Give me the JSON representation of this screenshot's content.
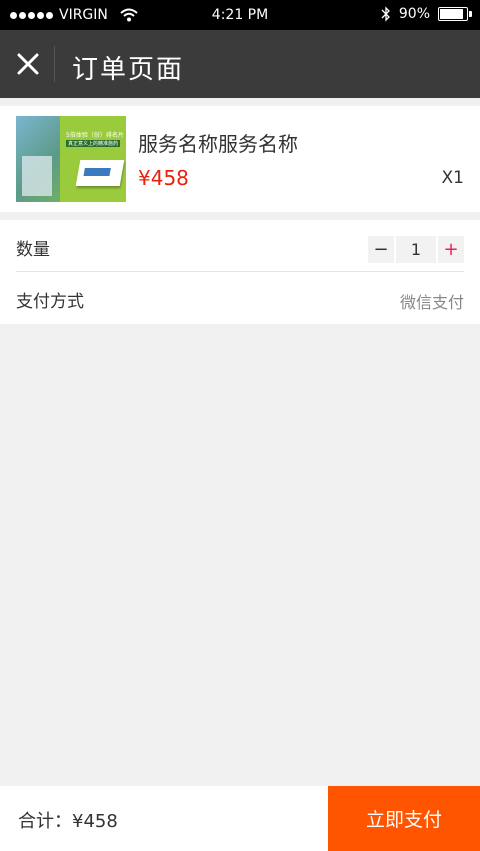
{
  "status_bar": {
    "carrier": "VIRGIN",
    "time": "4:21 PM",
    "battery": "90%",
    "battery_level": 0.9
  },
  "nav": {
    "title": "订单页面"
  },
  "product": {
    "image_text_line1": "5倍体验（份）排名片",
    "image_text_line2": "真正意义上的精准施药",
    "name": "服务名称服务名称",
    "price": "¥458",
    "quantity": "X1"
  },
  "options": {
    "quantity_label": "数量",
    "quantity_value": "1",
    "minus": "−",
    "plus": "+",
    "payment_label": "支付方式",
    "payment_value": "微信支付"
  },
  "footer": {
    "total_label": "合计：¥458",
    "pay_button": "立即支付"
  },
  "colors": {
    "price": "#e8230c",
    "pay_button": "#ff5500",
    "navbar": "#3b3b3b",
    "plus": "#e8235a"
  }
}
